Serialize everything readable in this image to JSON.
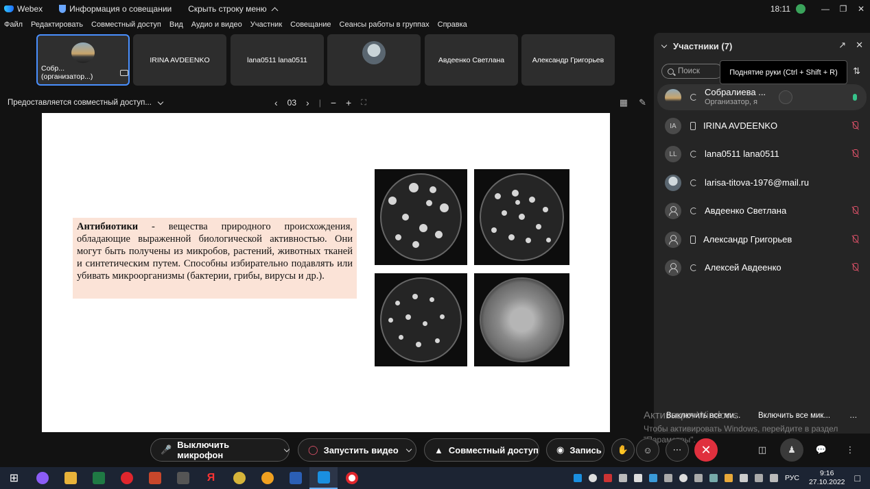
{
  "titlebar": {
    "app_name": "Webex",
    "meeting_info": "Информация о совещании",
    "hide_menu": "Скрыть строку меню",
    "time": "18:11"
  },
  "menu": [
    "Файл",
    "Редактировать",
    "Совместный доступ",
    "Вид",
    "Аудио и видео",
    "Участник",
    "Совещание",
    "Сеансы работы в группах",
    "Справка"
  ],
  "thumbnails": [
    {
      "label": "Собр... (организатор...)"
    },
    {
      "label": "IRINA AVDEENKO"
    },
    {
      "label": "lana0511 lana0511"
    },
    {
      "label": ""
    },
    {
      "label": "Авдеенко Светлана"
    },
    {
      "label": "Александр Григорьев"
    }
  ],
  "sharebar": {
    "label": "Предоставляется совместный доступ...",
    "page": "03"
  },
  "slide": {
    "term": "Антибиотики",
    "definition": " - вещества природного происхождения, обладающие выраженной биологической активностью. Они могут быть получены из микробов, растений, животных тканей и синтетическим путем. Способны избирательно подавлять или убивать микроорганизмы (бактерии, грибы, вирусы и др.)."
  },
  "panel": {
    "title": "Участники (7)",
    "search_placeholder": "Поиск",
    "tooltip": "Поднятие руки (Ctrl + Shift + R)",
    "participants": [
      {
        "initials": "",
        "name": "Собралиева ...",
        "sub": "Организатор, я",
        "muted": false
      },
      {
        "initials": "IA",
        "name": "IRINA AVDEENKO",
        "sub": "",
        "muted": true
      },
      {
        "initials": "LL",
        "name": "lana0511 lana0511",
        "sub": "",
        "muted": true
      },
      {
        "initials": "",
        "name": "larisa-titova-1976@mail.ru",
        "sub": "",
        "muted": false
      },
      {
        "initials": "",
        "name": "Авдеенко Светлана",
        "sub": "",
        "muted": true
      },
      {
        "initials": "",
        "name": "Александр Григорьев",
        "sub": "",
        "muted": true
      },
      {
        "initials": "",
        "name": "Алексей Авдеенко",
        "sub": "",
        "muted": true
      }
    ],
    "mute_all": "Выключить все ми...",
    "unmute_all": "Включить все мик..."
  },
  "watermark": {
    "line1": "Активация Windows",
    "line2": "Чтобы активировать Windows, перейдите в раздел",
    "line3": "\"Параметры\"."
  },
  "controls": {
    "mute": "Выключить микрофон",
    "video": "Запустить видео",
    "share": "Совместный доступ",
    "record": "Запись"
  },
  "taskbar": {
    "lang": "РУС",
    "time": "9:16",
    "date": "27.10.2022"
  }
}
